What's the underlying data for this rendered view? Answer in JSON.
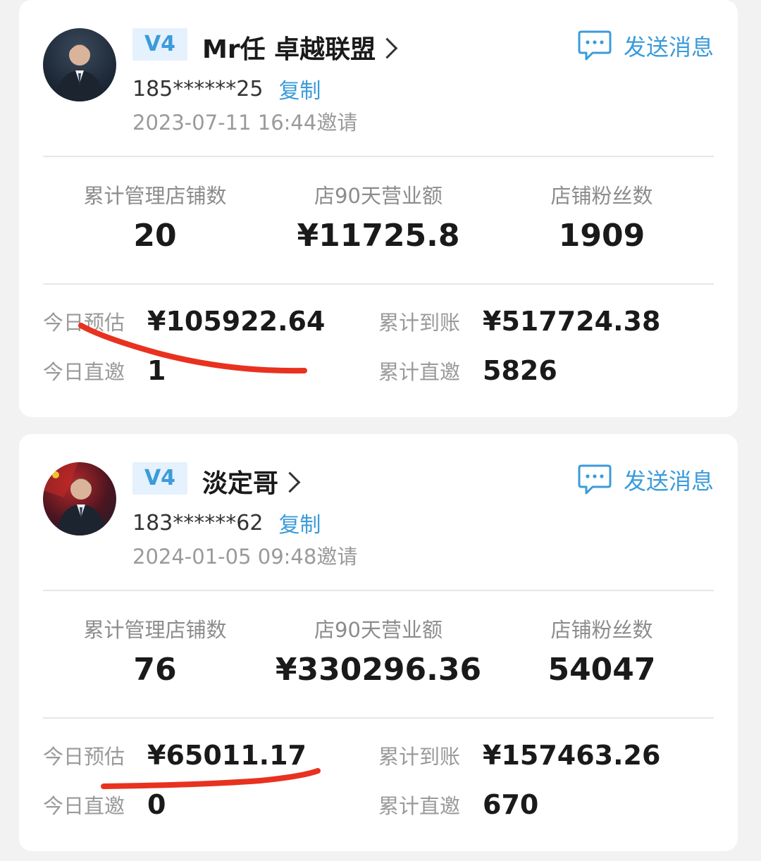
{
  "icons": {
    "send": "chat-bubble-icon",
    "chevron": "chevron-right-icon"
  },
  "colors": {
    "accent": "#3b9bdb",
    "badge_bg": "#e5f1fc",
    "mark": "#e8321f"
  },
  "cards": [
    {
      "level": "V4",
      "name": "Mr任 卓越联盟",
      "send_message": "发送消息",
      "phone": "185******25",
      "copy": "复制",
      "invite_time": "2023-07-11 16:44邀请",
      "stats": [
        {
          "label": "累计管理店铺数",
          "value": "20"
        },
        {
          "label": "店90天营业额",
          "value": "¥11725.8"
        },
        {
          "label": "店铺粉丝数",
          "value": "1909"
        }
      ],
      "metrics": {
        "today_estimate_label": "今日预估",
        "today_estimate": "¥105922.64",
        "total_received_label": "累计到账",
        "total_received": "¥517724.38",
        "today_direct_label": "今日直邀",
        "today_direct": "1",
        "total_direct_label": "累计直邀",
        "total_direct": "5826"
      }
    },
    {
      "level": "V4",
      "name": "淡定哥",
      "send_message": "发送消息",
      "phone": "183******62",
      "copy": "复制",
      "invite_time": "2024-01-05 09:48邀请",
      "stats": [
        {
          "label": "累计管理店铺数",
          "value": "76"
        },
        {
          "label": "店90天营业额",
          "value": "¥330296.36"
        },
        {
          "label": "店铺粉丝数",
          "value": "54047"
        }
      ],
      "metrics": {
        "today_estimate_label": "今日预估",
        "today_estimate": "¥65011.17",
        "total_received_label": "累计到账",
        "total_received": "¥157463.26",
        "today_direct_label": "今日直邀",
        "today_direct": "0",
        "total_direct_label": "累计直邀",
        "total_direct": "670"
      }
    }
  ]
}
